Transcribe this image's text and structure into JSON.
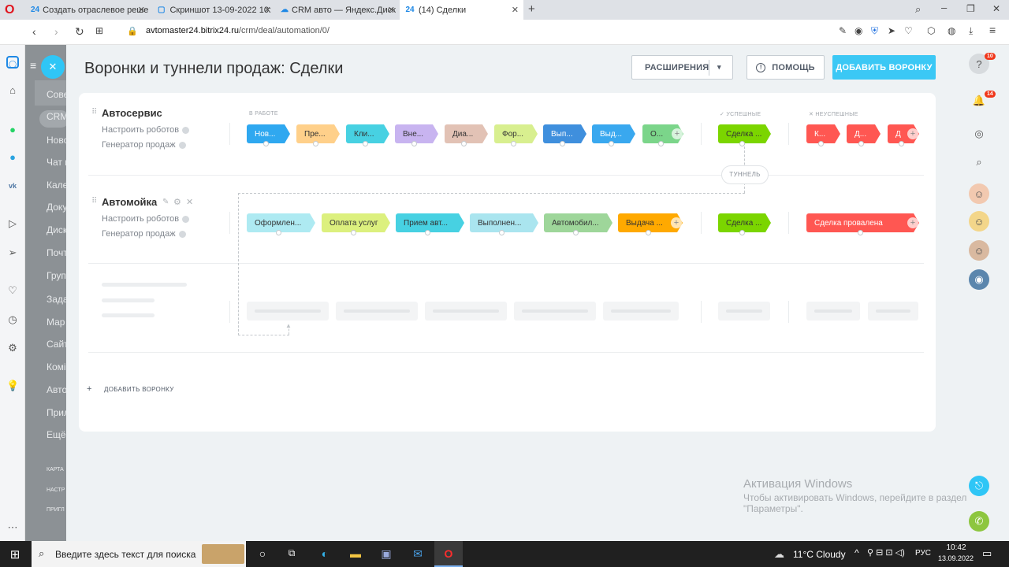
{
  "browser": {
    "tabs": [
      {
        "label": "Создать отраслевое реше"
      },
      {
        "label": "Скриншот 13-09-2022 10:"
      },
      {
        "label": "CRM авто — Яндекс.Диск"
      },
      {
        "label": "(14) Сделки"
      }
    ],
    "url_host": "avtomaster24.bitrix24.ru",
    "url_path": "/crm/deal/automation/0/"
  },
  "left_menu": [
    "Сове",
    "CRM",
    "Ново",
    "Чат и",
    "Кале",
    "Доку",
    "Диск",
    "Почт",
    "Груп",
    "Зада",
    "Мар",
    "Сайт",
    "Комі",
    "Авто",
    "Прил",
    "Ещё"
  ],
  "left_menu_small": [
    "КАРТА",
    "НАСТР",
    "ПРИГЛ"
  ],
  "header": {
    "title": "Воронки и туннели продаж: Сделки",
    "extensions": "РАСШИРЕНИЯ",
    "help": "ПОМОЩЬ",
    "add_funnel": "ДОБАВИТЬ ВОРОНКУ"
  },
  "columns": {
    "in_work": "В РАБОТЕ",
    "success": "УСПЕШНЫЕ",
    "fail": "НЕУСПЕШНЫЕ"
  },
  "tunnel_label": "ТУННЕЛЬ",
  "funnels": [
    {
      "name": "Автосервис",
      "robots": "Настроить роботов",
      "generator": "Генератор продаж",
      "stages": [
        {
          "label": "Нов...",
          "color": "#2fa8f0"
        },
        {
          "label": "Пре...",
          "color": "#ffd08a"
        },
        {
          "label": "Кли...",
          "color": "#47d1e2"
        },
        {
          "label": "Вне...",
          "color": "#c8b4f0"
        },
        {
          "label": "Диа...",
          "color": "#e2c2b5"
        },
        {
          "label": "Фор...",
          "color": "#d8ef8f"
        },
        {
          "label": "Вып...",
          "color": "#3f8fdd"
        },
        {
          "label": "Выд...",
          "color": "#39a8ef"
        },
        {
          "label": "О...",
          "color": "#7bd58a"
        }
      ],
      "success": {
        "label": "Сделка ...",
        "color": "#7bd500"
      },
      "fails": [
        {
          "label": "К...",
          "color": "#ff5752"
        },
        {
          "label": "Д...",
          "color": "#ff5752"
        },
        {
          "label": "Д",
          "color": "#ff5752"
        }
      ]
    },
    {
      "name": "Автомойка",
      "robots": "Настроить роботов",
      "generator": "Генератор продаж",
      "stages": [
        {
          "label": "Оформлен...",
          "color": "#aeeaf2"
        },
        {
          "label": "Оплата услуг",
          "color": "#dcf07e"
        },
        {
          "label": "Прием авт...",
          "color": "#47d1e2"
        },
        {
          "label": "Выполнен...",
          "color": "#aae5ef"
        },
        {
          "label": "Автомобил...",
          "color": "#9ed69a"
        },
        {
          "label": "Выдача ...",
          "color": "#ffa900"
        }
      ],
      "success": {
        "label": "Сделка ...",
        "color": "#7bd500"
      },
      "fails": [
        {
          "label": "Сделка провалена",
          "color": "#ff5752"
        }
      ]
    }
  ],
  "add_funnel_link": "ДОБАВИТЬ ВОРОНКУ",
  "right_bar": {
    "help_badge": "10",
    "notif_badge": "14"
  },
  "watermark": {
    "title": "Активация Windows",
    "line1": "Чтобы активировать Windows, перейдите в раздел",
    "line2": "\"Параметры\"."
  },
  "taskbar": {
    "search_placeholder": "Введите здесь текст для поиска",
    "weather": "11°C  Cloudy",
    "lang": "РУС",
    "time": "10:42",
    "date": "13.09.2022"
  }
}
